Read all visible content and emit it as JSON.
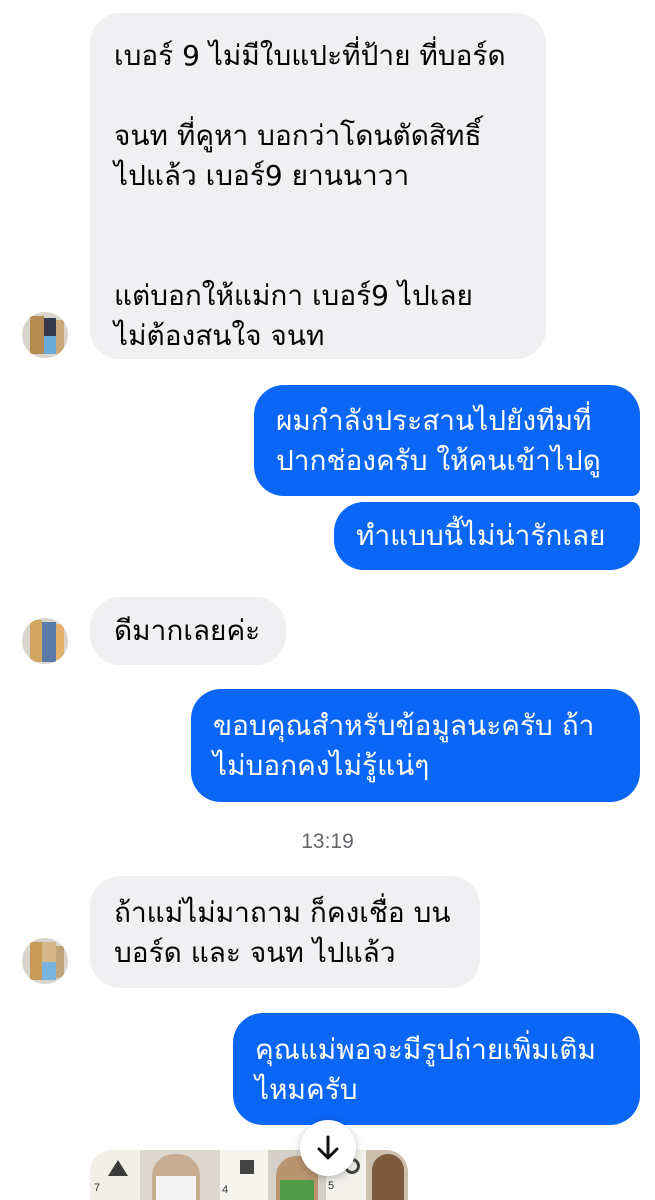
{
  "messages": [
    {
      "from": "contact",
      "text": "เบอร์ 9 ไม่มีใบแปะที่ป้าย ที่บอร์ด\n\nจนท ที่คูหา บอกว่าโดนตัดสิทธิ์\nไปแล้ว เบอร์9 ยานนาวา\n\n\nแต่บอกให้แม่กา เบอร์9 ไปเลย\nไม่ต้องสนใจ จนท"
    },
    {
      "from": "me",
      "text": "ผมกำลังประสานไปยังทีมที่\nปากช่องครับ ให้คนเข้าไปดู"
    },
    {
      "from": "me",
      "text": "ทำแบบนี้ไม่น่ารักเลย"
    },
    {
      "from": "contact",
      "text": "ดีมากเลยค่ะ"
    },
    {
      "from": "me",
      "text": "ขอบคุณสำหรับข้อมูลนะครับ ถ้า\nไม่บอกคงไม่รู้แน่ๆ"
    },
    {
      "from": "contact",
      "text": "ถ้าแม่ไม่มาถาม ก็คงเชื่อ บน\nบอร์ด และ จนท ไปแล้ว"
    },
    {
      "from": "me",
      "text": "คุณแม่พอจะมีรูปถ่ายเพิ่มเติม\nไหมครับ"
    }
  ],
  "timestamp": "13:19",
  "scroll_button": {
    "icon": "arrow-down-icon"
  },
  "photo_preview": {
    "visible_numbers": [
      "7",
      "4",
      "5"
    ]
  },
  "colors": {
    "outgoing_bubble": "#0a66f5",
    "incoming_bubble": "#f0f0f2",
    "timestamp_text": "#65676b"
  }
}
